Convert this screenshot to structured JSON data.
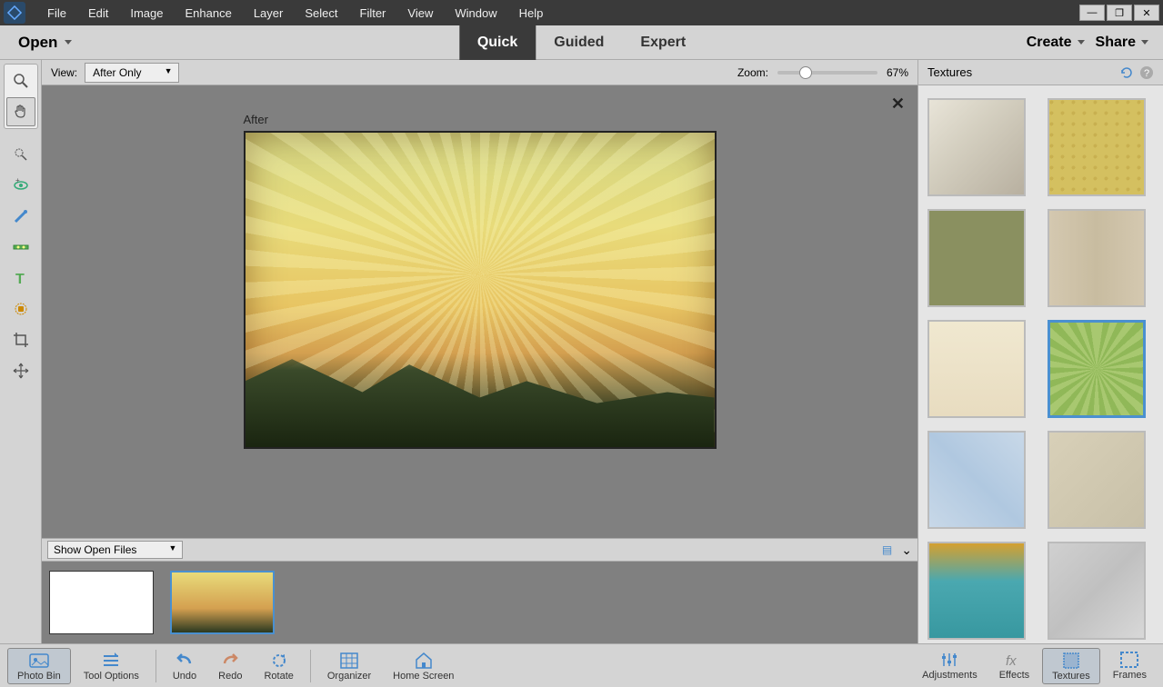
{
  "menu": [
    "File",
    "Edit",
    "Image",
    "Enhance",
    "Layer",
    "Select",
    "Filter",
    "View",
    "Window",
    "Help"
  ],
  "open_label": "Open",
  "modes": {
    "quick": "Quick",
    "guided": "Guided",
    "expert": "Expert"
  },
  "create_label": "Create",
  "share_label": "Share",
  "view_label": "View:",
  "view_value": "After Only",
  "zoom_label": "Zoom:",
  "zoom_value": "67%",
  "image_label": "After",
  "show_files_label": "Show Open Files",
  "panel_title": "Textures",
  "bottom": {
    "photobin": "Photo Bin",
    "tooloptions": "Tool Options",
    "undo": "Undo",
    "redo": "Redo",
    "rotate": "Rotate",
    "organizer": "Organizer",
    "homescreen": "Home Screen",
    "adjustments": "Adjustments",
    "effects": "Effects",
    "textures": "Textures",
    "frames": "Frames"
  },
  "textures": [
    {
      "name": "peeling-paint",
      "bg": "linear-gradient(135deg,#e8e4d8 0%,#d4cfc0 40%,#b8b0a0 100%)"
    },
    {
      "name": "yellow-dots",
      "bg": "radial-gradient(circle at 20% 20%, #c8b050 2px, transparent 2px), #d4c060"
    },
    {
      "name": "olive-canvas",
      "bg": "#8a9060"
    },
    {
      "name": "beige-fabric",
      "bg": "linear-gradient(90deg,#d4c8b0,#c8bca0,#d4c8b0)"
    },
    {
      "name": "cream-paper",
      "bg": "linear-gradient(180deg,#f0e8d0,#e8dcc0)"
    },
    {
      "name": "green-sunburst",
      "bg": "repeating-conic-gradient(from 0deg at 50% 50%, #a8c870 0deg 8deg, #90b858 8deg 16deg)",
      "selected": true
    },
    {
      "name": "blue-weave",
      "bg": "linear-gradient(45deg,#c8d8e8,#b0c8e0,#c8d8e8)"
    },
    {
      "name": "tan-scratched",
      "bg": "linear-gradient(135deg,#d8d0b8,#c8c0a8)"
    },
    {
      "name": "teal-gold",
      "bg": "linear-gradient(180deg,#d4a030 0%,#4aa8b0 40%,#3898a0 100%)"
    },
    {
      "name": "silver-foil",
      "bg": "linear-gradient(135deg,#d0d0d0,#c0c0c0,#d8d8d8)"
    }
  ]
}
